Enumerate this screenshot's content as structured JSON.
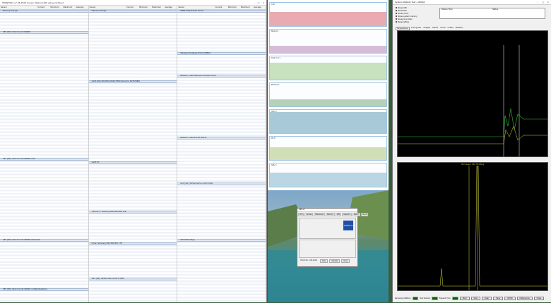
{
  "hwinfo": {
    "title": "HWiNFO64 v7.06-4500 Sensor Status [185 values hidden]",
    "columns": [
      "Sensor",
      "Current",
      "Minimum",
      "Maximum",
      "Average"
    ],
    "groups_col1": [
      "Memory Timings",
      "CPU [#0]: Intel Core i9-12900K",
      "CPU [#0]: Intel Core i9-12900K: DTS",
      "CPU [#0]: Intel Core i9-12900K: Enhanced",
      "CPU [#0]: Intel Core i9-12900K: C-State Residency"
    ],
    "groups_col2": [
      "Memory Timings",
      "ASUS ROG MAXIMUS Z690 HERO (Nuvoton NCT6798D)",
      "ASUS EC",
      "S.M.A.R.T.: Samsung SSD 980 PRO 1TB",
      "Drive: Samsung SSD 980 PRO 1TB",
      "GPU [#0]: NVIDIA GeForce RTX 3080"
    ],
    "groups_col3": [
      "DIMM Temperature Sensor",
      "Windows Hardware Errors (WHEA)",
      "Network: Intel Ethernet Controller I225-V",
      "Network: Intel Wi-Fi 6E AX211",
      "GPU [#0]: NVIDIA GeForce RTX 3080",
      "GPU D3D Usage"
    ]
  },
  "taskmgr": {
    "tiles": [
      {
        "label": "CPU",
        "color": "#e38f97"
      },
      {
        "label": "Memory",
        "color": "#c8a6cc"
      },
      {
        "label": "Disk 0 (C:)",
        "color": "#b7d7a8"
      },
      {
        "label": "Ethernet",
        "color": "#9ec3a2"
      },
      {
        "label": "GPU 0",
        "color": "#8cb7c9"
      },
      {
        "label": "Wi-Fi",
        "color": "#c3d4a0"
      },
      {
        "label": "GPU 1",
        "color": "#a3c8d8"
      }
    ]
  },
  "cpuz": {
    "title": "CPU-Z",
    "tabs": [
      "CPU",
      "Caches",
      "Mainboard",
      "Memory",
      "SPD",
      "Graphics",
      "Bench",
      "About"
    ],
    "logo": "CORE i9",
    "buttons": [
      "Tools",
      "Validate",
      "Close"
    ],
    "version": "CPU-Z Ver. 1.99.0.x64"
  },
  "stability": {
    "title": "System Stability Test - AIDA64",
    "options": [
      "Stress CPU",
      "Stress FPU",
      "Stress cache",
      "Stress system memory",
      "Stress local disks",
      "Stress GPU(s)"
    ],
    "info_labels": [
      "Date & Time",
      "Status"
    ],
    "tabs": [
      "Temperatures",
      "Cooling Fans",
      "Voltages",
      "Powers",
      "Clocks",
      "Unified",
      "Statistics"
    ],
    "graph_bottom_label": "CPU Usage  |  CPU Throttling",
    "status_items": [
      "Remaining Battery:",
      "Test Started:",
      "Elapsed Time:"
    ],
    "buttons": [
      "Start",
      "Stop",
      "Clear",
      "Save",
      "CPUID",
      "Preferences",
      "Close"
    ],
    "accent": "#2f7d2f"
  }
}
